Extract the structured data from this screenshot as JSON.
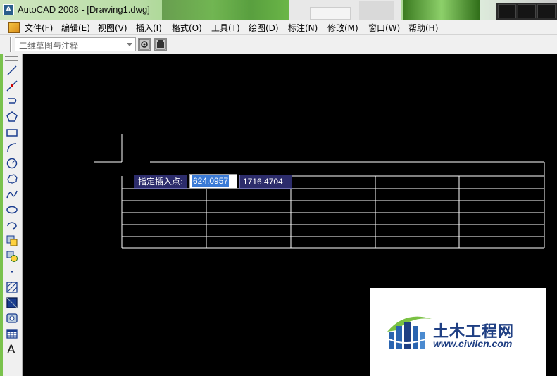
{
  "window": {
    "title": "AutoCAD 2008 - [Drawing1.dwg]",
    "icon": "autocad-app-icon"
  },
  "menu": {
    "items": [
      {
        "label": "文件(F)"
      },
      {
        "label": "编辑(E)"
      },
      {
        "label": "视图(V)"
      },
      {
        "label": "插入(I)"
      },
      {
        "label": "格式(O)"
      },
      {
        "label": "工具(T)"
      },
      {
        "label": "绘图(D)"
      },
      {
        "label": "标注(N)"
      },
      {
        "label": "修改(M)"
      },
      {
        "label": "窗口(W)"
      },
      {
        "label": "帮助(H)"
      }
    ]
  },
  "toolbar": {
    "workspace": "二维草图与注释",
    "buttons": [
      "workspace-settings-icon",
      "my-workspace-icon"
    ]
  },
  "draw_toolbar": {
    "tools": [
      "line-icon",
      "construction-line-icon",
      "polyline-icon",
      "polygon-icon",
      "rectangle-icon",
      "arc-icon",
      "circle-icon",
      "revision-cloud-icon",
      "spline-icon",
      "ellipse-icon",
      "ellipse-arc-icon",
      "insert-block-icon",
      "make-block-icon",
      "point-icon",
      "hatch-icon",
      "gradient-icon",
      "region-icon",
      "table-icon",
      "multiline-text-icon"
    ],
    "text_tool_label": "A"
  },
  "dynamic_input": {
    "prompt": "指定插入点:",
    "x_value": "624.0957",
    "y_value": "1716.4704"
  },
  "watermark": {
    "name": "土木工程网",
    "url": "www.civilcn.com"
  },
  "colors": {
    "canvas": "#000000",
    "tooltip_bg": "#2c2c6b",
    "highlight": "#3b7bd6",
    "watermark_text": "#1f3f83"
  }
}
